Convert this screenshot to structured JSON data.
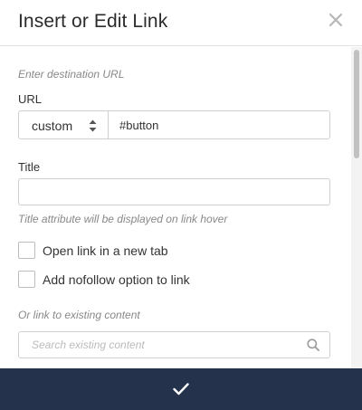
{
  "dialog": {
    "title": "Insert or Edit Link"
  },
  "url_section": {
    "hint": "Enter destination URL",
    "label": "URL",
    "link_type_selected": "custom",
    "url_value": "#button"
  },
  "title_section": {
    "label": "Title",
    "value": "",
    "hint": "Title attribute will be displayed on link hover"
  },
  "options": [
    {
      "label": "Open link in a new tab",
      "checked": false
    },
    {
      "label": "Add nofollow option to link",
      "checked": false
    }
  ],
  "existing_content": {
    "hint": "Or link to existing content",
    "search_placeholder": "Search existing content"
  },
  "icons": {
    "close": "close-icon",
    "select_arrows": "sort-arrows-icon",
    "search": "search-icon",
    "confirm": "checkmark-icon"
  },
  "colors": {
    "footer_bg": "#24324b",
    "confirm_icon": "#ffffff"
  }
}
